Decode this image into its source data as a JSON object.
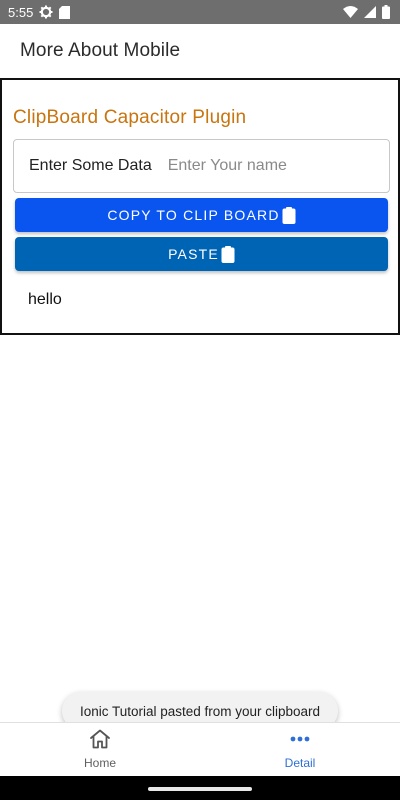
{
  "status_bar": {
    "time": "5:55",
    "icons": [
      "settings-gear-icon",
      "sd-card-icon",
      "wifi-icon",
      "cellular-signal-icon",
      "battery-icon"
    ]
  },
  "header": {
    "title": "More About Mobile"
  },
  "card": {
    "title": "ClipBoard Capacitor Plugin",
    "title_color": "#c8740f",
    "input": {
      "label": "Enter Some Data",
      "placeholder": "Enter Your name",
      "value": ""
    },
    "copy_button": {
      "label": "COPY TO CLIP BOARD",
      "icon": "clipboard-icon",
      "color": "#0a55f0"
    },
    "paste_button": {
      "label": "PASTE",
      "icon": "clipboard-icon",
      "color": "#0064b4"
    },
    "pasted_text": "hello"
  },
  "toast": {
    "message": "Ionic Tutorial pasted from your clipboard"
  },
  "tabs": [
    {
      "label": "Home",
      "icon": "home-icon",
      "selected": false
    },
    {
      "label": "Detail",
      "icon": "ellipsis-icon",
      "selected": true,
      "color": "#2f6fd6"
    }
  ]
}
